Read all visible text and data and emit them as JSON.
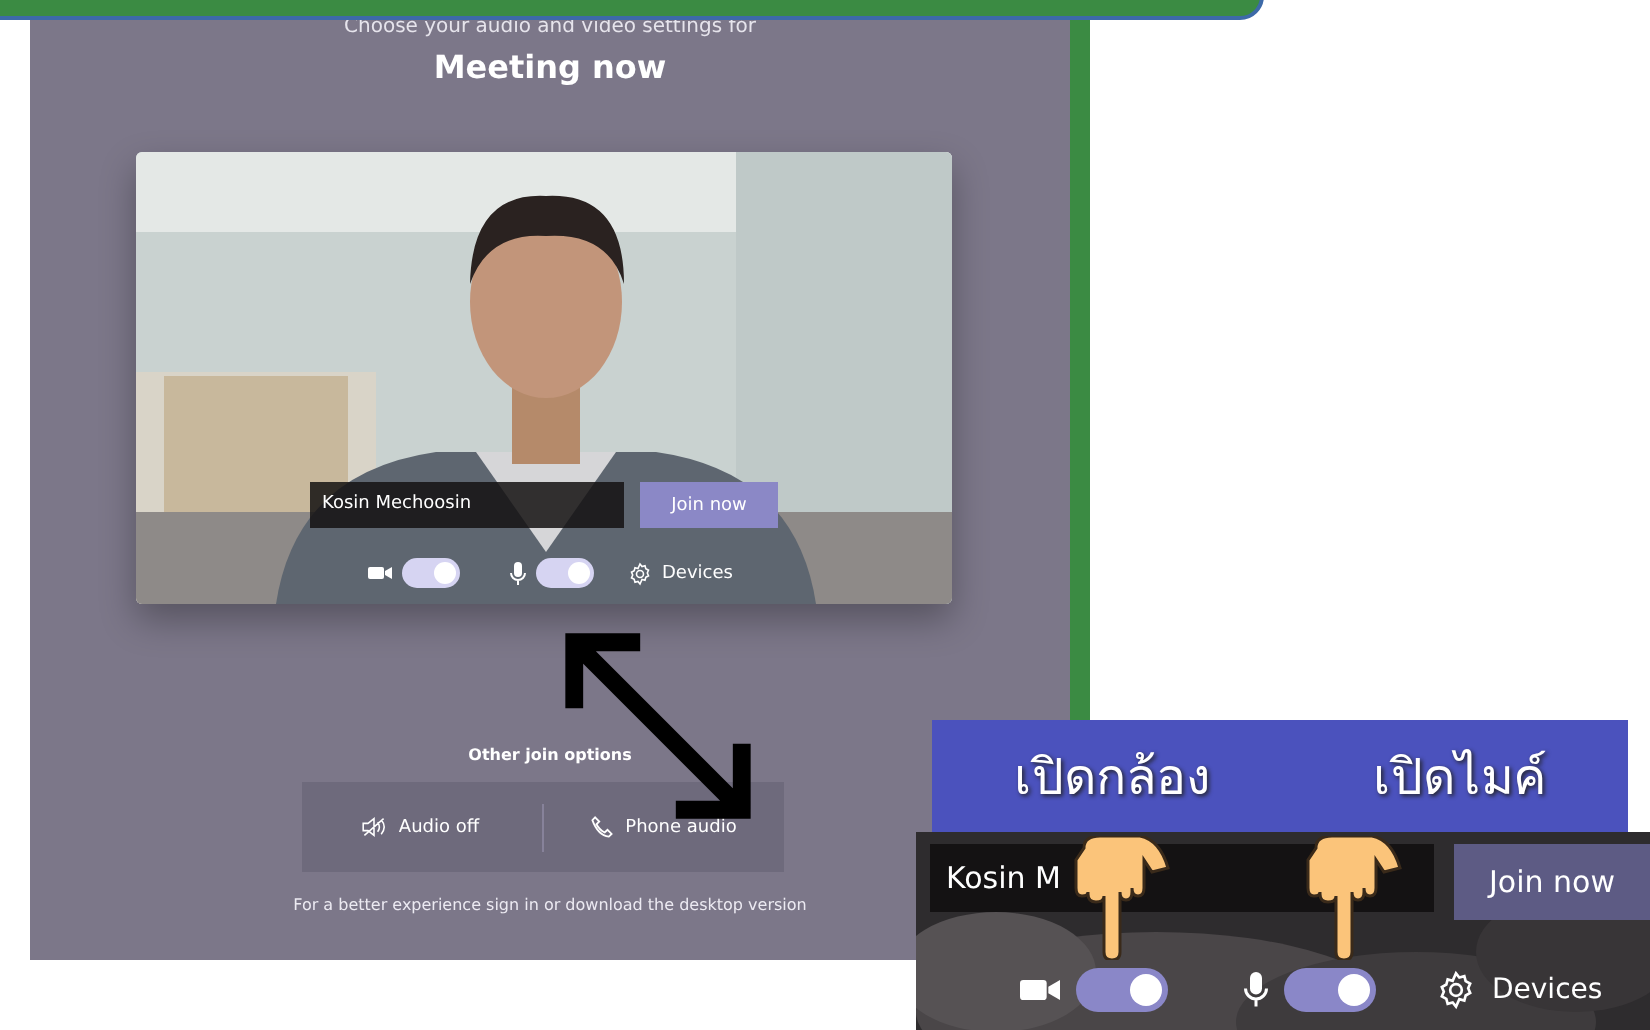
{
  "header": {
    "subtitle": "Choose your audio and video settings for",
    "title": "Meeting now"
  },
  "preview": {
    "name_field": {
      "value": "Kosin Mechoosin"
    },
    "join_button": "Join now",
    "camera_toggle": {
      "on": true
    },
    "mic_toggle": {
      "on": true
    },
    "devices_button": "Devices"
  },
  "other_join_options": {
    "title": "Other join options",
    "options": [
      {
        "kind": "audio-off",
        "label": "Audio off"
      },
      {
        "kind": "phone",
        "label": "Phone audio"
      }
    ]
  },
  "footer": "For a better experience sign in or download the desktop version",
  "callout": {
    "labels": [
      "เปิดกล้อง",
      "เปิดไมค์"
    ],
    "name_field": {
      "value": "Kosin M"
    },
    "join_button": "Join now",
    "camera_toggle": {
      "on": true
    },
    "mic_toggle": {
      "on": true
    },
    "devices_button": "Devices"
  }
}
